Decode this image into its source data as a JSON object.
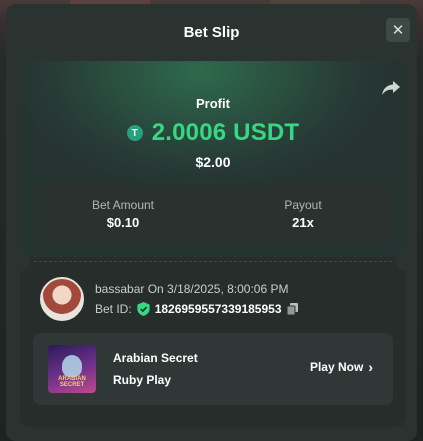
{
  "modal": {
    "title": "Bet Slip"
  },
  "profit": {
    "label": "Profit",
    "currency_icon": "T",
    "value": "2.0006 USDT",
    "fiat": "$2.00"
  },
  "stats": {
    "bet_amount_label": "Bet Amount",
    "bet_amount_value": "$0.10",
    "payout_label": "Payout",
    "payout_value": "21x"
  },
  "user": {
    "username": "bassabar",
    "played_on": "On 3/18/2025, 8:00:06 PM",
    "bet_id_label": "Bet ID:",
    "bet_id": "1826959557339185953"
  },
  "game": {
    "name": "Arabian Secret",
    "provider": "Ruby Play",
    "thumb_text": "ARABIAN SECRET",
    "play_label": "Play Now",
    "play_chevron": "›"
  },
  "colors": {
    "profit": "#35d883",
    "usdt": "#26a17b"
  }
}
